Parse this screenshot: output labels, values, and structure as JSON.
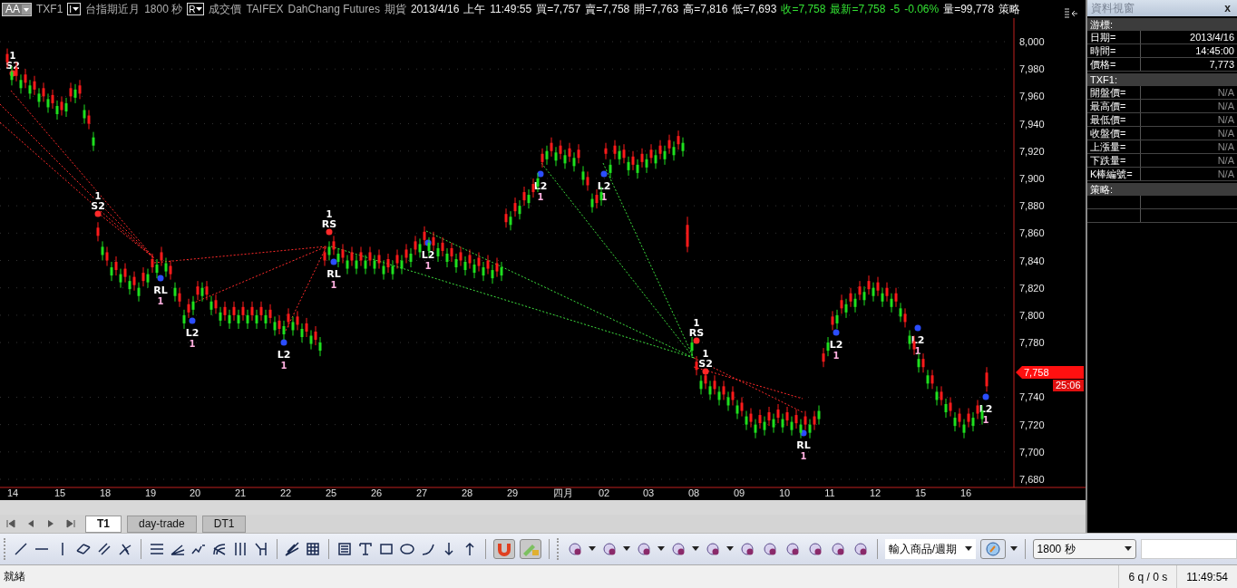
{
  "header": {
    "style_button": "AA",
    "symbol": "TXF1",
    "interval_button": "I",
    "name": "台指期近月",
    "period": "1800 秒",
    "price_type_button": "R",
    "price_type": "成交價",
    "exchange": "TAIFEX",
    "broker": "DahChang Futures",
    "market": "期貨",
    "date": "2013/4/16",
    "ampm": "上午",
    "time": "11:49:55",
    "quotes": [
      {
        "text": "買=7,757",
        "kind": "plain"
      },
      {
        "text": "賣=7,758",
        "kind": "plain"
      },
      {
        "text": "開=7,763",
        "kind": "plain"
      },
      {
        "text": "高=7,816",
        "kind": "plain"
      },
      {
        "text": "低=7,693",
        "kind": "plain"
      },
      {
        "text": "收=7,758",
        "kind": "change"
      },
      {
        "text": "最新=7,758",
        "kind": "change"
      },
      {
        "text": "-5",
        "kind": "change"
      },
      {
        "text": "-0.06%",
        "kind": "change"
      },
      {
        "text": "量=99,778",
        "kind": "plain"
      },
      {
        "text": "策略",
        "kind": "plain"
      }
    ]
  },
  "chart": {
    "chart_data": {
      "type": "candlestick",
      "ylim": [
        7680,
        8000
      ],
      "yticks": [
        {
          "value": 8000,
          "label": "8,000"
        },
        {
          "value": 7980,
          "label": "7,980"
        },
        {
          "value": 7960,
          "label": "7,960"
        },
        {
          "value": 7940,
          "label": "7,940"
        },
        {
          "value": 7920,
          "label": "7,920"
        },
        {
          "value": 7900,
          "label": "7,900"
        },
        {
          "value": 7880,
          "label": "7,880"
        },
        {
          "value": 7860,
          "label": "7,860"
        },
        {
          "value": 7840,
          "label": "7,840"
        },
        {
          "value": 7820,
          "label": "7,820"
        },
        {
          "value": 7800,
          "label": "7,800"
        },
        {
          "value": 7780,
          "label": "7,780"
        },
        {
          "value": 7740,
          "label": "7,740"
        },
        {
          "value": 7720,
          "label": "7,720"
        },
        {
          "value": 7700,
          "label": "7,700"
        },
        {
          "value": 7680,
          "label": "7,680"
        }
      ],
      "grid": true,
      "ohlc": [
        [
          7985,
          7995,
          7981,
          7991
        ],
        [
          7978,
          7982,
          7968,
          7972
        ],
        [
          7975,
          7985,
          7971,
          7981
        ],
        [
          7972,
          7976,
          7962,
          7966
        ],
        [
          7970,
          7980,
          7966,
          7976
        ],
        [
          7968,
          7972,
          7958,
          7962
        ],
        [
          7965,
          7975,
          7961,
          7971
        ],
        [
          7962,
          7966,
          7952,
          7956
        ],
        [
          7960,
          7970,
          7956,
          7966
        ],
        [
          7958,
          7962,
          7948,
          7952
        ],
        [
          7955,
          7965,
          7951,
          7961
        ],
        [
          7953,
          7957,
          7943,
          7947
        ],
        [
          7950,
          7960,
          7946,
          7956
        ],
        [
          7955,
          7959,
          7945,
          7949
        ],
        [
          7960,
          7970,
          7956,
          7966
        ],
        [
          7965,
          7969,
          7955,
          7959
        ],
        [
          7962,
          7972,
          7958,
          7968
        ],
        [
          7950,
          7954,
          7940,
          7944
        ],
        [
          7940,
          7950,
          7936,
          7946
        ],
        [
          7930,
          7934,
          7920,
          7924
        ],
        [
          7858,
          7868,
          7854,
          7864
        ],
        [
          7850,
          7854,
          7840,
          7844
        ],
        [
          7840,
          7850,
          7836,
          7846
        ],
        [
          7835,
          7839,
          7825,
          7829
        ],
        [
          7833,
          7843,
          7829,
          7839
        ],
        [
          7830,
          7834,
          7820,
          7824
        ],
        [
          7828,
          7838,
          7824,
          7834
        ],
        [
          7825,
          7829,
          7815,
          7819
        ],
        [
          7822,
          7832,
          7818,
          7828
        ],
        [
          7820,
          7824,
          7810,
          7814
        ],
        [
          7825,
          7835,
          7821,
          7831
        ],
        [
          7830,
          7834,
          7820,
          7824
        ],
        [
          7835,
          7845,
          7831,
          7841
        ],
        [
          7837,
          7841,
          7827,
          7831
        ],
        [
          7840,
          7850,
          7836,
          7846
        ],
        [
          7838,
          7842,
          7828,
          7832
        ],
        [
          7830,
          7840,
          7826,
          7836
        ],
        [
          7820,
          7824,
          7810,
          7814
        ],
        [
          7810,
          7820,
          7806,
          7816
        ],
        [
          7800,
          7804,
          7790,
          7794
        ],
        [
          7802,
          7812,
          7798,
          7808
        ],
        [
          7810,
          7814,
          7800,
          7804
        ],
        [
          7815,
          7825,
          7811,
          7821
        ],
        [
          7820,
          7824,
          7810,
          7814
        ],
        [
          7815,
          7825,
          7811,
          7821
        ],
        [
          7810,
          7814,
          7800,
          7804
        ],
        [
          7805,
          7815,
          7801,
          7811
        ],
        [
          7802,
          7806,
          7792,
          7796
        ],
        [
          7800,
          7810,
          7796,
          7806
        ],
        [
          7800,
          7804,
          7790,
          7794
        ],
        [
          7800,
          7810,
          7796,
          7806
        ],
        [
          7800,
          7804,
          7790,
          7794
        ],
        [
          7800,
          7810,
          7796,
          7806
        ],
        [
          7800,
          7804,
          7790,
          7794
        ],
        [
          7800,
          7810,
          7796,
          7806
        ],
        [
          7800,
          7804,
          7790,
          7794
        ],
        [
          7800,
          7810,
          7796,
          7806
        ],
        [
          7800,
          7804,
          7790,
          7794
        ],
        [
          7798,
          7808,
          7794,
          7804
        ],
        [
          7795,
          7799,
          7785,
          7789
        ],
        [
          7790,
          7800,
          7786,
          7796
        ],
        [
          7792,
          7796,
          7782,
          7786
        ],
        [
          7795,
          7805,
          7791,
          7801
        ],
        [
          7795,
          7799,
          7785,
          7789
        ],
        [
          7793,
          7803,
          7789,
          7799
        ],
        [
          7790,
          7794,
          7780,
          7784
        ],
        [
          7788,
          7798,
          7784,
          7794
        ],
        [
          7785,
          7789,
          7775,
          7779
        ],
        [
          7782,
          7792,
          7778,
          7788
        ],
        [
          7780,
          7784,
          7770,
          7774
        ],
        [
          7840,
          7850,
          7836,
          7846
        ],
        [
          7850,
          7854,
          7840,
          7844
        ],
        [
          7848,
          7858,
          7844,
          7854
        ],
        [
          7845,
          7849,
          7835,
          7839
        ],
        [
          7842,
          7852,
          7838,
          7848
        ],
        [
          7840,
          7844,
          7830,
          7834
        ],
        [
          7840,
          7850,
          7836,
          7846
        ],
        [
          7840,
          7844,
          7830,
          7834
        ],
        [
          7840,
          7850,
          7836,
          7846
        ],
        [
          7840,
          7844,
          7830,
          7834
        ],
        [
          7840,
          7850,
          7836,
          7846
        ],
        [
          7840,
          7844,
          7830,
          7834
        ],
        [
          7838,
          7848,
          7834,
          7844
        ],
        [
          7836,
          7840,
          7826,
          7830
        ],
        [
          7835,
          7845,
          7831,
          7841
        ],
        [
          7836,
          7840,
          7826,
          7830
        ],
        [
          7838,
          7848,
          7834,
          7844
        ],
        [
          7840,
          7844,
          7830,
          7834
        ],
        [
          7842,
          7852,
          7838,
          7848
        ],
        [
          7845,
          7849,
          7835,
          7839
        ],
        [
          7848,
          7858,
          7844,
          7854
        ],
        [
          7852,
          7856,
          7842,
          7846
        ],
        [
          7855,
          7865,
          7851,
          7861
        ],
        [
          7853,
          7857,
          7843,
          7847
        ],
        [
          7851,
          7861,
          7847,
          7857
        ],
        [
          7849,
          7853,
          7839,
          7843
        ],
        [
          7847,
          7857,
          7843,
          7853
        ],
        [
          7845,
          7849,
          7835,
          7839
        ],
        [
          7843,
          7853,
          7839,
          7849
        ],
        [
          7841,
          7845,
          7831,
          7835
        ],
        [
          7840,
          7850,
          7836,
          7846
        ],
        [
          7839,
          7843,
          7829,
          7833
        ],
        [
          7838,
          7848,
          7834,
          7844
        ],
        [
          7837,
          7841,
          7827,
          7831
        ],
        [
          7836,
          7846,
          7832,
          7842
        ],
        [
          7835,
          7839,
          7825,
          7829
        ],
        [
          7834,
          7844,
          7830,
          7840
        ],
        [
          7833,
          7837,
          7823,
          7827
        ],
        [
          7832,
          7842,
          7828,
          7838
        ],
        [
          7835,
          7839,
          7825,
          7829
        ],
        [
          7868,
          7878,
          7864,
          7874
        ],
        [
          7872,
          7876,
          7862,
          7866
        ],
        [
          7876,
          7886,
          7872,
          7882
        ],
        [
          7880,
          7884,
          7870,
          7874
        ],
        [
          7884,
          7894,
          7880,
          7890
        ],
        [
          7888,
          7892,
          7878,
          7882
        ],
        [
          7890,
          7900,
          7886,
          7896
        ],
        [
          7900,
          7904,
          7890,
          7894
        ],
        [
          7912,
          7922,
          7908,
          7918
        ],
        [
          7920,
          7924,
          7910,
          7914
        ],
        [
          7920,
          7930,
          7916,
          7926
        ],
        [
          7919,
          7923,
          7909,
          7913
        ],
        [
          7918,
          7928,
          7914,
          7924
        ],
        [
          7917,
          7921,
          7907,
          7911
        ],
        [
          7916,
          7926,
          7912,
          7922
        ],
        [
          7915,
          7919,
          7905,
          7909
        ],
        [
          7915,
          7925,
          7911,
          7921
        ],
        [
          7905,
          7909,
          7895,
          7899
        ],
        [
          7895,
          7905,
          7891,
          7901
        ],
        [
          7885,
          7889,
          7875,
          7879
        ],
        [
          7882,
          7892,
          7878,
          7888
        ],
        [
          7890,
          7894,
          7880,
          7884
        ],
        [
          7918,
          7926,
          7914,
          7922
        ],
        [
          7910,
          7914,
          7900,
          7904
        ],
        [
          7918,
          7928,
          7914,
          7924
        ],
        [
          7920,
          7924,
          7910,
          7914
        ],
        [
          7915,
          7925,
          7911,
          7921
        ],
        [
          7912,
          7916,
          7902,
          7906
        ],
        [
          7910,
          7920,
          7906,
          7916
        ],
        [
          7910,
          7914,
          7900,
          7904
        ],
        [
          7912,
          7922,
          7908,
          7918
        ],
        [
          7914,
          7918,
          7904,
          7908
        ],
        [
          7915,
          7925,
          7911,
          7921
        ],
        [
          7917,
          7921,
          7907,
          7911
        ],
        [
          7918,
          7928,
          7914,
          7924
        ],
        [
          7920,
          7924,
          7910,
          7914
        ],
        [
          7922,
          7932,
          7918,
          7928
        ],
        [
          7923,
          7927,
          7913,
          7917
        ],
        [
          7925,
          7935,
          7921,
          7931
        ],
        [
          7926,
          7930,
          7916,
          7920
        ],
        [
          7850,
          7872,
          7846,
          7866
        ],
        [
          7780,
          7784,
          7770,
          7774
        ],
        [
          7760,
          7770,
          7756,
          7766
        ],
        [
          7752,
          7756,
          7742,
          7746
        ],
        [
          7750,
          7760,
          7746,
          7756
        ],
        [
          7748,
          7752,
          7738,
          7742
        ],
        [
          7746,
          7756,
          7742,
          7752
        ],
        [
          7744,
          7748,
          7734,
          7738
        ],
        [
          7742,
          7752,
          7738,
          7748
        ],
        [
          7740,
          7744,
          7730,
          7734
        ],
        [
          7738,
          7748,
          7734,
          7744
        ],
        [
          7734,
          7738,
          7724,
          7728
        ],
        [
          7730,
          7740,
          7726,
          7736
        ],
        [
          7726,
          7730,
          7716,
          7720
        ],
        [
          7722,
          7732,
          7718,
          7728
        ],
        [
          7720,
          7724,
          7710,
          7714
        ],
        [
          7721,
          7731,
          7717,
          7727
        ],
        [
          7722,
          7726,
          7712,
          7716
        ],
        [
          7723,
          7733,
          7719,
          7729
        ],
        [
          7724,
          7728,
          7714,
          7718
        ],
        [
          7725,
          7735,
          7721,
          7731
        ],
        [
          7724,
          7728,
          7714,
          7718
        ],
        [
          7723,
          7733,
          7719,
          7729
        ],
        [
          7722,
          7726,
          7712,
          7716
        ],
        [
          7721,
          7731,
          7717,
          7727
        ],
        [
          7720,
          7724,
          7710,
          7714
        ],
        [
          7720,
          7730,
          7716,
          7726
        ],
        [
          7720,
          7724,
          7710,
          7714
        ],
        [
          7720,
          7730,
          7716,
          7726
        ],
        [
          7730,
          7734,
          7720,
          7724
        ],
        [
          7766,
          7776,
          7762,
          7772
        ],
        [
          7780,
          7784,
          7770,
          7774
        ],
        [
          7793,
          7803,
          7789,
          7799
        ],
        [
          7800,
          7804,
          7790,
          7794
        ],
        [
          7805,
          7815,
          7801,
          7811
        ],
        [
          7808,
          7812,
          7798,
          7802
        ],
        [
          7810,
          7820,
          7806,
          7816
        ],
        [
          7812,
          7816,
          7802,
          7806
        ],
        [
          7815,
          7825,
          7811,
          7821
        ],
        [
          7817,
          7821,
          7807,
          7811
        ],
        [
          7819,
          7829,
          7815,
          7825
        ],
        [
          7820,
          7824,
          7810,
          7814
        ],
        [
          7818,
          7828,
          7814,
          7824
        ],
        [
          7816,
          7820,
          7806,
          7810
        ],
        [
          7814,
          7824,
          7810,
          7820
        ],
        [
          7812,
          7816,
          7802,
          7806
        ],
        [
          7810,
          7820,
          7806,
          7816
        ],
        [
          7805,
          7809,
          7795,
          7799
        ],
        [
          7795,
          7805,
          7791,
          7801
        ],
        [
          7785,
          7789,
          7775,
          7779
        ],
        [
          7775,
          7785,
          7771,
          7781
        ],
        [
          7768,
          7772,
          7758,
          7762
        ],
        [
          7762,
          7772,
          7758,
          7768
        ],
        [
          7756,
          7760,
          7746,
          7750
        ],
        [
          7750,
          7760,
          7746,
          7756
        ],
        [
          7744,
          7748,
          7734,
          7738
        ],
        [
          7738,
          7748,
          7734,
          7744
        ],
        [
          7735,
          7739,
          7725,
          7729
        ],
        [
          7730,
          7740,
          7726,
          7736
        ],
        [
          7725,
          7729,
          7715,
          7719
        ],
        [
          7722,
          7732,
          7718,
          7728
        ],
        [
          7720,
          7724,
          7710,
          7714
        ],
        [
          7722,
          7732,
          7718,
          7728
        ],
        [
          7725,
          7729,
          7715,
          7719
        ],
        [
          7728,
          7738,
          7724,
          7734
        ],
        [
          7730,
          7734,
          7720,
          7724
        ],
        [
          7748,
          7762,
          7744,
          7758
        ]
      ]
    },
    "date_labels": [
      "14",
      "15",
      "18",
      "19",
      "20",
      "21",
      "22",
      "25",
      "26",
      "27",
      "28",
      "29",
      "四月",
      "02",
      "03",
      "08",
      "09",
      "10",
      "11",
      "12",
      "15",
      "16"
    ],
    "current_price": "7,758",
    "countdown": "25:06",
    "signals": [
      {
        "label": "S2",
        "count": "1",
        "kind": "sell"
      },
      {
        "label": "S2",
        "count": "1",
        "kind": "sell"
      },
      {
        "label": "RL",
        "count": "1",
        "kind": "buy"
      },
      {
        "label": "L2",
        "count": "1",
        "kind": "buy"
      },
      {
        "label": "L2",
        "count": "1",
        "kind": "buy"
      },
      {
        "label": "RS",
        "count": "1",
        "kind": "sell"
      },
      {
        "label": "RL",
        "count": "1",
        "kind": "buy"
      },
      {
        "label": "L2",
        "count": "1",
        "kind": "buy"
      },
      {
        "label": "L2",
        "count": "1",
        "kind": "buy"
      },
      {
        "label": "L2",
        "count": "1",
        "kind": "buy"
      },
      {
        "label": "RS",
        "count": "1",
        "kind": "sell"
      },
      {
        "label": "S2",
        "count": "1",
        "kind": "sell"
      },
      {
        "label": "RL",
        "count": "1",
        "kind": "buy"
      },
      {
        "label": "L2",
        "count": "1",
        "kind": "buy"
      },
      {
        "label": "L2",
        "count": "1",
        "kind": "buy"
      },
      {
        "label": "L2",
        "count": "1",
        "kind": "buy"
      }
    ]
  },
  "data_window": {
    "title": "資料視窗",
    "close": "x",
    "sections": [
      {
        "header": "游標:",
        "rows": [
          {
            "label": "日期=",
            "value": "2013/4/16",
            "available": true
          },
          {
            "label": "時間=",
            "value": "14:45:00",
            "available": true
          },
          {
            "label": "價格=",
            "value": "7,773",
            "available": true
          }
        ]
      },
      {
        "header": "TXF1:",
        "rows": [
          {
            "label": "開盤價=",
            "value": "N/A",
            "available": false
          },
          {
            "label": "最高價=",
            "value": "N/A",
            "available": false
          },
          {
            "label": "最低價=",
            "value": "N/A",
            "available": false
          },
          {
            "label": "收盤價=",
            "value": "N/A",
            "available": false
          },
          {
            "label": "上漲量=",
            "value": "N/A",
            "available": false
          },
          {
            "label": "下跌量=",
            "value": "N/A",
            "available": false
          },
          {
            "label": "K棒編號=",
            "value": "N/A",
            "available": false
          }
        ]
      },
      {
        "header": "策略:"
      }
    ]
  },
  "sheet_tabs": [
    {
      "label": "T1",
      "selected": true
    },
    {
      "label": "day-trade",
      "selected": false
    },
    {
      "label": "DT1",
      "selected": false
    }
  ],
  "toolbar": {
    "symbol_combo": "輸入商品/週期",
    "period_select": "1800 秒"
  },
  "status_bar": {
    "message": "就緒",
    "queue": "6 q / 0 s",
    "time": "11:49:54"
  }
}
